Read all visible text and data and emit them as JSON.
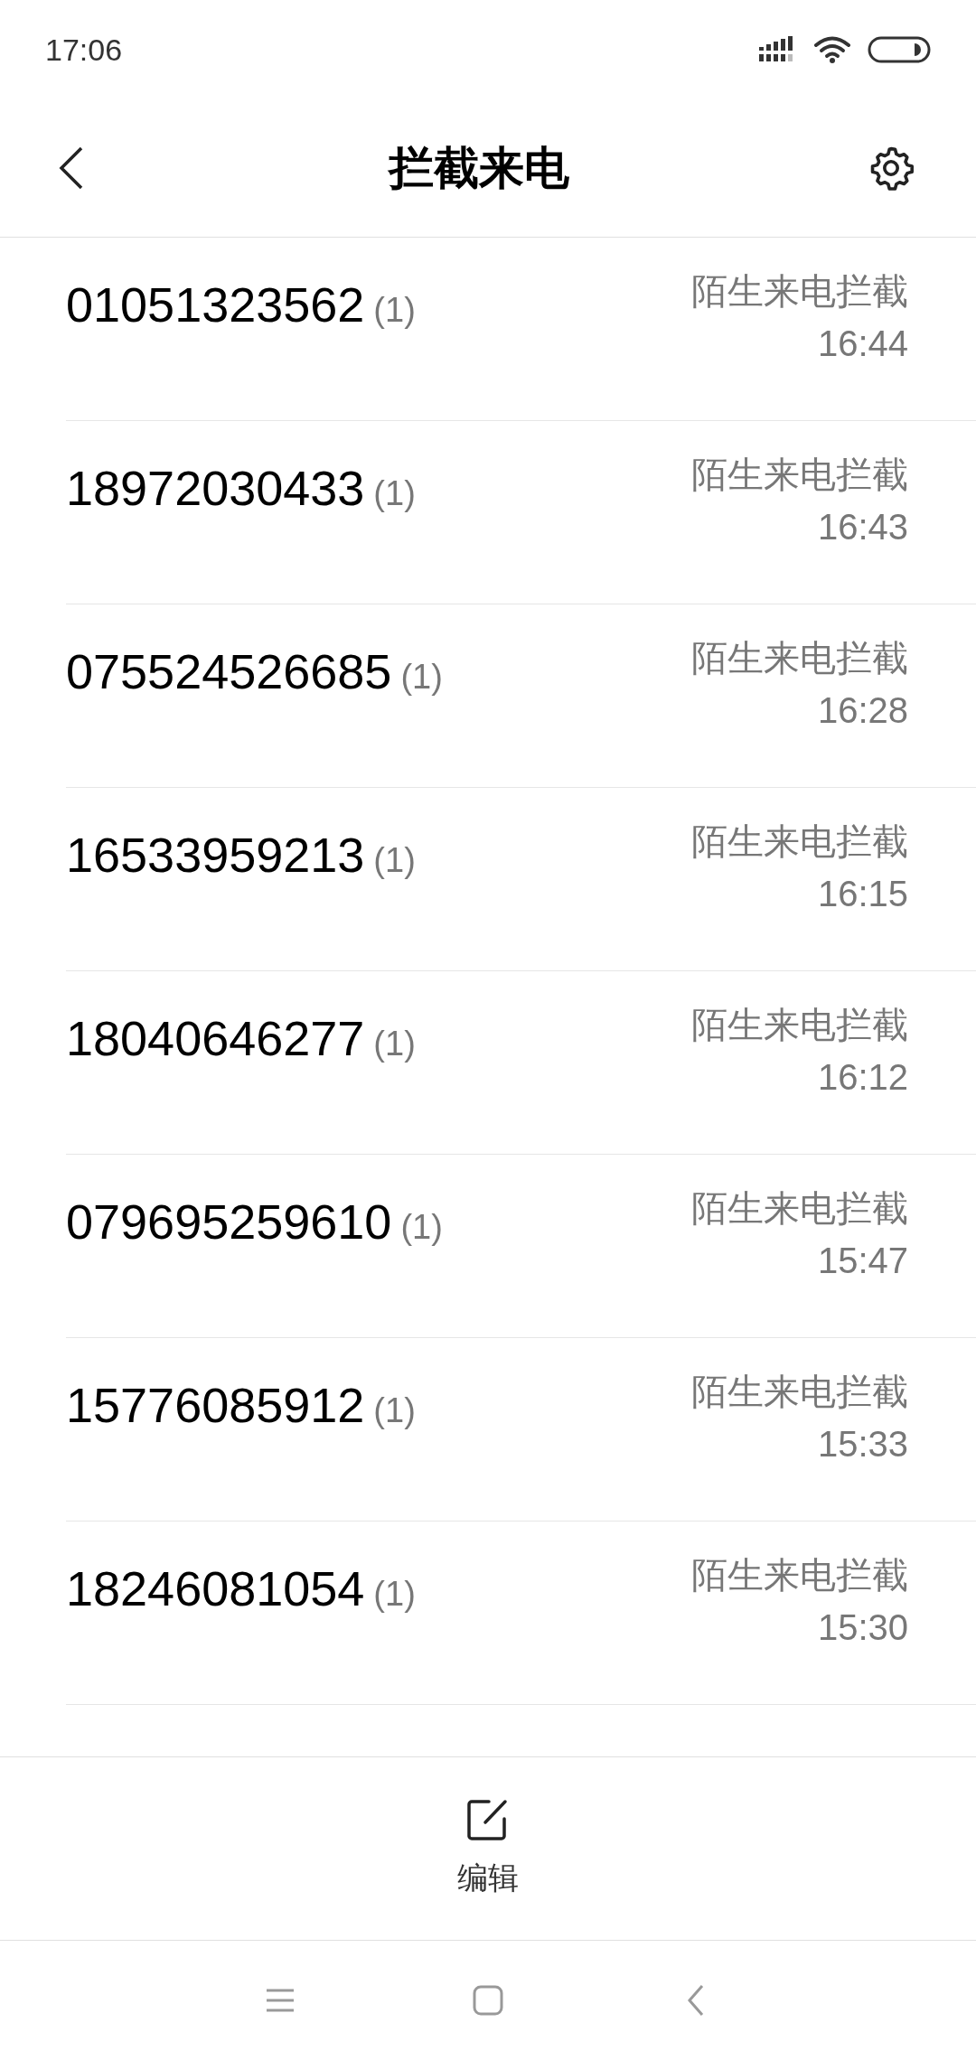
{
  "status_bar": {
    "time": "17:06"
  },
  "header": {
    "title": "拦截来电"
  },
  "calls": [
    {
      "number": "01051323562",
      "count": "(1)",
      "label": "陌生来电拦截",
      "time": "16:44"
    },
    {
      "number": "18972030433",
      "count": "(1)",
      "label": "陌生来电拦截",
      "time": "16:43"
    },
    {
      "number": "075524526685",
      "count": "(1)",
      "label": "陌生来电拦截",
      "time": "16:28"
    },
    {
      "number": "16533959213",
      "count": "(1)",
      "label": "陌生来电拦截",
      "time": "16:15"
    },
    {
      "number": "18040646277",
      "count": "(1)",
      "label": "陌生来电拦截",
      "time": "16:12"
    },
    {
      "number": "079695259610",
      "count": "(1)",
      "label": "陌生来电拦截",
      "time": "15:47"
    },
    {
      "number": "15776085912",
      "count": "(1)",
      "label": "陌生来电拦截",
      "time": "15:33"
    },
    {
      "number": "18246081054",
      "count": "(1)",
      "label": "陌生来电拦截",
      "time": "15:30"
    }
  ],
  "bottom_bar": {
    "edit_label": "编辑"
  }
}
